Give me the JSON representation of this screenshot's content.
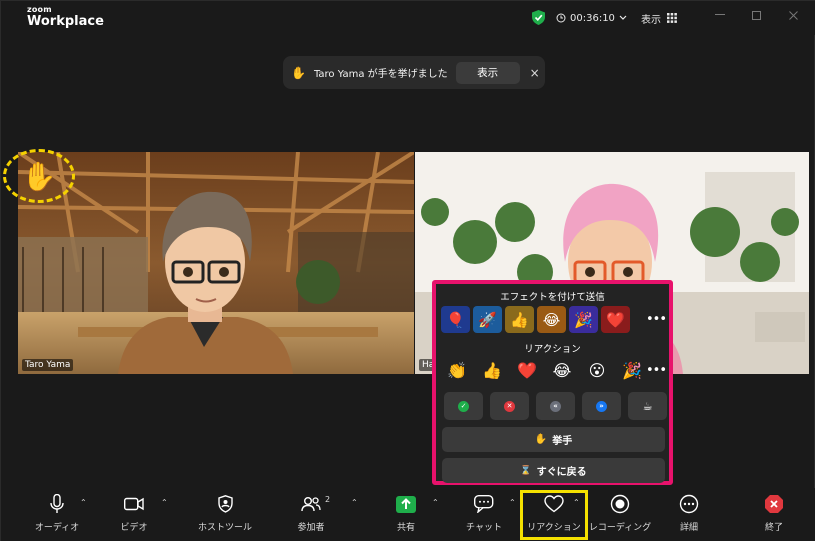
{
  "app": {
    "logo_small": "zoom",
    "logo_big": "Workplace",
    "timer": "00:36:10",
    "view_label": "表示"
  },
  "toast": {
    "message": "Taro Yama が手を挙げました",
    "show_label": "表示",
    "close_glyph": "×",
    "hand_glyph": "✋"
  },
  "participants": [
    {
      "name": "Taro Yama"
    },
    {
      "name": "Ha"
    }
  ],
  "reactions_panel": {
    "effects_title": "エフェクトを付けて送信",
    "effects": [
      {
        "glyph": "🎈",
        "bg": "#1f3a8f"
      },
      {
        "glyph": "🚀",
        "bg": "#1c5c9c"
      },
      {
        "glyph": "👍",
        "bg": "#8a6a1c"
      },
      {
        "glyph": "😂",
        "bg": "#9a5a14"
      },
      {
        "glyph": "🎉",
        "bg": "#3a2c9c"
      },
      {
        "glyph": "❤️",
        "bg": "#8a1c1c"
      }
    ],
    "reactions_title": "リアクション",
    "reactions": [
      "👏",
      "👍",
      "❤️",
      "😂",
      "😮",
      "🎉"
    ],
    "more_glyph": "•••",
    "status": [
      {
        "name": "yes",
        "glyph": "✓",
        "color": "#1fae4b"
      },
      {
        "name": "no",
        "glyph": "✕",
        "color": "#e0383e"
      },
      {
        "name": "slower",
        "glyph": "«",
        "color": "#6b6f7a"
      },
      {
        "name": "faster",
        "glyph": "»",
        "color": "#1677f2"
      },
      {
        "name": "coffee",
        "glyph": "☕",
        "color": "#3a3a3a"
      }
    ],
    "raise_hand_label": "挙手",
    "raise_hand_glyph": "✋",
    "back_label": "すぐに戻る",
    "back_glyph": "⌛"
  },
  "toolbar": {
    "audio": "オーディオ",
    "video": "ビデオ",
    "host_tools": "ホストツール",
    "participants": "参加者",
    "participants_count": "2",
    "share": "共有",
    "chat": "チャット",
    "reactions": "リアクション",
    "recording": "レコーディング",
    "more": "詳細",
    "end": "終了"
  },
  "colors": {
    "highlight_pink": "#e8126c",
    "highlight_yellow": "#f5e100",
    "share_green": "#1fae4b",
    "end_red": "#e0383e"
  }
}
